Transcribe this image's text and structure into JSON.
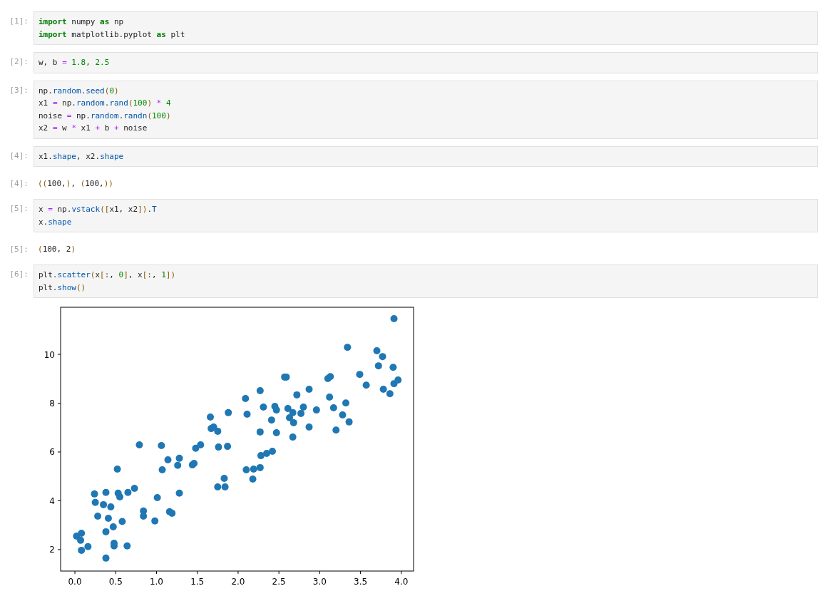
{
  "cells": [
    {
      "kind": "code",
      "prompt": "[1]:",
      "lines": [
        [
          {
            "kind": "kw",
            "text": "import"
          },
          {
            "kind": "name",
            "text": " numpy "
          },
          {
            "kind": "kw",
            "text": "as"
          },
          {
            "kind": "name",
            "text": " np"
          }
        ],
        [
          {
            "kind": "kw",
            "text": "import"
          },
          {
            "kind": "name",
            "text": " matplotlib.pyplot "
          },
          {
            "kind": "kw",
            "text": "as"
          },
          {
            "kind": "name",
            "text": " plt"
          }
        ]
      ]
    },
    {
      "kind": "code",
      "prompt": "[2]:",
      "lines": [
        [
          {
            "kind": "name",
            "text": "w, b "
          },
          {
            "kind": "op",
            "text": "="
          },
          {
            "kind": "num",
            "text": " 1.8"
          },
          {
            "kind": "name",
            "text": ", "
          },
          {
            "kind": "num",
            "text": "2.5"
          }
        ]
      ]
    },
    {
      "kind": "code",
      "prompt": "[3]:",
      "lines": [
        [
          {
            "kind": "name",
            "text": "np."
          },
          {
            "kind": "prop",
            "text": "random"
          },
          {
            "kind": "name",
            "text": "."
          },
          {
            "kind": "prop",
            "text": "seed"
          },
          {
            "kind": "punct",
            "text": "("
          },
          {
            "kind": "num",
            "text": "0"
          },
          {
            "kind": "punct",
            "text": ")"
          }
        ],
        [
          {
            "kind": "name",
            "text": "x1 "
          },
          {
            "kind": "op",
            "text": "="
          },
          {
            "kind": "name",
            "text": " np."
          },
          {
            "kind": "prop",
            "text": "random"
          },
          {
            "kind": "name",
            "text": "."
          },
          {
            "kind": "prop",
            "text": "rand"
          },
          {
            "kind": "punct",
            "text": "("
          },
          {
            "kind": "num",
            "text": "100"
          },
          {
            "kind": "punct",
            "text": ")"
          },
          {
            "kind": "op",
            "text": " * "
          },
          {
            "kind": "num",
            "text": "4"
          }
        ],
        [
          {
            "kind": "name",
            "text": "noise "
          },
          {
            "kind": "op",
            "text": "="
          },
          {
            "kind": "name",
            "text": " np."
          },
          {
            "kind": "prop",
            "text": "random"
          },
          {
            "kind": "name",
            "text": "."
          },
          {
            "kind": "prop",
            "text": "randn"
          },
          {
            "kind": "punct",
            "text": "("
          },
          {
            "kind": "num",
            "text": "100"
          },
          {
            "kind": "punct",
            "text": ")"
          }
        ],
        [
          {
            "kind": "name",
            "text": "x2 "
          },
          {
            "kind": "op",
            "text": "="
          },
          {
            "kind": "name",
            "text": " w "
          },
          {
            "kind": "op",
            "text": "*"
          },
          {
            "kind": "name",
            "text": " x1 "
          },
          {
            "kind": "op",
            "text": "+"
          },
          {
            "kind": "name",
            "text": " b "
          },
          {
            "kind": "op",
            "text": "+"
          },
          {
            "kind": "name",
            "text": " noise"
          }
        ]
      ]
    },
    {
      "kind": "code",
      "prompt": "[4]:",
      "lines": [
        [
          {
            "kind": "name",
            "text": "x1."
          },
          {
            "kind": "prop",
            "text": "shape"
          },
          {
            "kind": "name",
            "text": ", x2."
          },
          {
            "kind": "prop",
            "text": "shape"
          }
        ]
      ]
    },
    {
      "kind": "output",
      "prompt": "[4]:",
      "lines": [
        [
          {
            "kind": "punct",
            "text": "(("
          },
          {
            "kind": "name",
            "text": "100,"
          },
          {
            "kind": "punct",
            "text": ")"
          },
          {
            "kind": "name",
            "text": ", "
          },
          {
            "kind": "punct",
            "text": "("
          },
          {
            "kind": "name",
            "text": "100,"
          },
          {
            "kind": "punct",
            "text": "))"
          }
        ]
      ]
    },
    {
      "kind": "code",
      "prompt": "[5]:",
      "lines": [
        [
          {
            "kind": "name",
            "text": "x "
          },
          {
            "kind": "op",
            "text": "="
          },
          {
            "kind": "name",
            "text": " np."
          },
          {
            "kind": "prop",
            "text": "vstack"
          },
          {
            "kind": "punct",
            "text": "(["
          },
          {
            "kind": "name",
            "text": "x1, x2"
          },
          {
            "kind": "punct",
            "text": "])"
          },
          {
            "kind": "name",
            "text": "."
          },
          {
            "kind": "prop",
            "text": "T"
          }
        ],
        [
          {
            "kind": "name",
            "text": "x."
          },
          {
            "kind": "prop",
            "text": "shape"
          }
        ]
      ]
    },
    {
      "kind": "output",
      "prompt": "[5]:",
      "lines": [
        [
          {
            "kind": "punct",
            "text": "("
          },
          {
            "kind": "name",
            "text": "100, 2"
          },
          {
            "kind": "punct",
            "text": ")"
          }
        ]
      ]
    },
    {
      "kind": "code",
      "prompt": "[6]:",
      "lines": [
        [
          {
            "kind": "name",
            "text": "plt."
          },
          {
            "kind": "prop",
            "text": "scatter"
          },
          {
            "kind": "punct",
            "text": "("
          },
          {
            "kind": "name",
            "text": "x"
          },
          {
            "kind": "punct",
            "text": "["
          },
          {
            "kind": "name",
            "text": ":, "
          },
          {
            "kind": "num",
            "text": "0"
          },
          {
            "kind": "punct",
            "text": "]"
          },
          {
            "kind": "name",
            "text": ", x"
          },
          {
            "kind": "punct",
            "text": "["
          },
          {
            "kind": "name",
            "text": ":, "
          },
          {
            "kind": "num",
            "text": "1"
          },
          {
            "kind": "punct",
            "text": "])"
          }
        ],
        [
          {
            "kind": "name",
            "text": "plt."
          },
          {
            "kind": "prop",
            "text": "show"
          },
          {
            "kind": "punct",
            "text": "()"
          }
        ]
      ]
    }
  ],
  "figure": {
    "chart_data": {
      "type": "scatter",
      "xlim": [
        -0.175,
        4.15
      ],
      "ylim": [
        1.12,
        11.93
      ],
      "xticks": [
        {
          "value": 0,
          "label": "0.0"
        },
        {
          "value": 0.5,
          "label": "0.5"
        },
        {
          "value": 1,
          "label": "1.0"
        },
        {
          "value": 1.5,
          "label": "1.5"
        },
        {
          "value": 2,
          "label": "2.0"
        },
        {
          "value": 2.5,
          "label": "2.5"
        },
        {
          "value": 3,
          "label": "3.0"
        },
        {
          "value": 3.5,
          "label": "3.5"
        },
        {
          "value": 4,
          "label": "4.0"
        }
      ],
      "yticks": [
        2,
        4,
        6,
        8,
        10
      ],
      "x": [
        0.02,
        0.08,
        0.07,
        0.08,
        0.16,
        0.24,
        0.25,
        0.28,
        0.35,
        0.38,
        0.38,
        0.38,
        0.41,
        0.44,
        0.47,
        0.48,
        0.48,
        0.52,
        0.53,
        0.55,
        0.58,
        0.64,
        0.65,
        0.73,
        0.79,
        0.84,
        0.84,
        0.98,
        1.01,
        1.06,
        1.07,
        1.14,
        1.16,
        1.19,
        1.26,
        1.28,
        1.28,
        1.44,
        1.46,
        1.48,
        1.54,
        1.66,
        1.67,
        1.7,
        1.75,
        1.75,
        1.76,
        1.83,
        1.84,
        1.87,
        1.88,
        2.09,
        2.11,
        2.1,
        2.19,
        2.18,
        2.27,
        2.31,
        2.27,
        2.28,
        2.27,
        2.35,
        2.42,
        2.41,
        2.45,
        2.47,
        2.47,
        2.57,
        2.59,
        2.61,
        2.63,
        2.67,
        2.68,
        2.67,
        2.72,
        2.77,
        2.8,
        2.87,
        2.87,
        2.96,
        3.1,
        3.13,
        3.12,
        3.17,
        3.2,
        3.28,
        3.32,
        3.36,
        3.34,
        3.49,
        3.57,
        3.7,
        3.72,
        3.77,
        3.78,
        3.86,
        3.9,
        3.91,
        3.91,
        3.96
      ],
      "series": [
        {
          "color": "#1f77b4",
          "values": [
            2.55,
            2.67,
            2.38,
            1.97,
            2.12,
            4.28,
            3.93,
            3.37,
            3.84,
            4.34,
            2.73,
            1.65,
            3.28,
            3.75,
            2.93,
            2.15,
            2.26,
            5.3,
            4.31,
            4.16,
            3.15,
            2.15,
            4.34,
            4.51,
            6.29,
            3.58,
            3.37,
            3.17,
            4.13,
            6.26,
            5.27,
            5.68,
            3.55,
            3.49,
            5.45,
            5.74,
            4.31,
            5.47,
            5.53,
            6.15,
            6.29,
            7.43,
            6.96,
            7.02,
            6.85,
            4.57,
            6.2,
            4.92,
            4.57,
            6.23,
            7.61,
            8.19,
            7.55,
            5.27,
            5.3,
            4.89,
            8.51,
            7.84,
            6.82,
            5.85,
            5.36,
            5.94,
            6.03,
            7.31,
            7.87,
            7.72,
            6.79,
            9.07,
            9.07,
            7.78,
            7.4,
            7.61,
            7.2,
            6.61,
            8.34,
            7.58,
            7.84,
            8.57,
            7.02,
            7.72,
            9.01,
            9.09,
            8.25,
            7.81,
            6.9,
            7.52,
            8.01,
            7.23,
            10.29,
            9.18,
            8.74,
            10.15,
            9.53,
            9.91,
            8.57,
            8.39,
            9.47,
            11.46,
            8.8,
            8.95
          ]
        }
      ]
    }
  }
}
